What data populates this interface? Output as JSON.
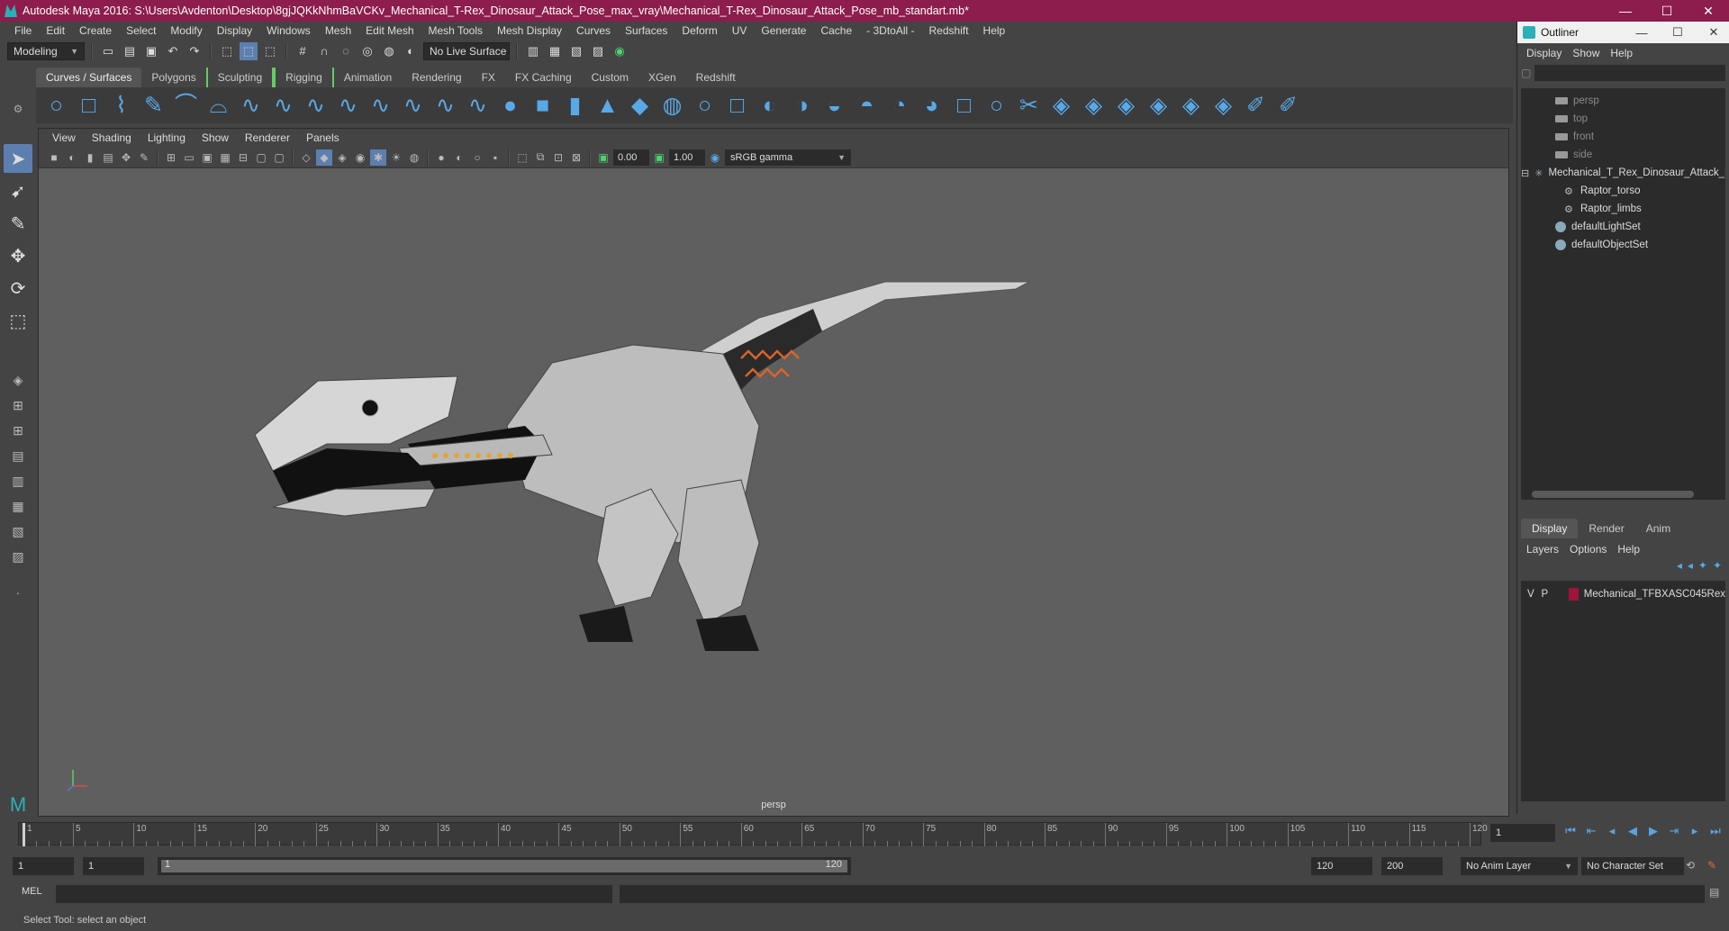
{
  "window": {
    "title": "Autodesk Maya 2016: S:\\Users\\Avdenton\\Desktop\\8gjJQKkNhmBaVCKv_Mechanical_T-Rex_Dinosaur_Attack_Pose_max_vray\\Mechanical_T-Rex_Dinosaur_Attack_Pose_mb_standart.mb*",
    "minimize": "—",
    "maximize": "☐",
    "close": "✕"
  },
  "menubar": [
    "File",
    "Edit",
    "Create",
    "Select",
    "Modify",
    "Display",
    "Windows",
    "Mesh",
    "Edit Mesh",
    "Mesh Tools",
    "Mesh Display",
    "Curves",
    "Surfaces",
    "Deform",
    "UV",
    "Generate",
    "Cache",
    "- 3DtoAll -",
    "Redshift",
    "Help"
  ],
  "statusline": {
    "mode": "Modeling",
    "live_surface": "No Live Surface"
  },
  "shelf_tabs": [
    "Curves / Surfaces",
    "Polygons",
    "Sculpting",
    "Rigging",
    "Animation",
    "Rendering",
    "FX",
    "FX Caching",
    "Custom",
    "XGen",
    "Redshift"
  ],
  "shelf_active": "Curves / Surfaces",
  "shelf_icons": [
    "circle-icon",
    "square-icon",
    "cv-curve-icon",
    "pencil-curve-icon",
    "ep-curve-icon",
    "arc-icon",
    "bezier-icon",
    "curve-icon",
    "curve-icon",
    "curve-icon",
    "curve-icon",
    "curve-icon",
    "curve-icon",
    "curve-icon",
    "sphere-icon",
    "cube-icon",
    "cylinder-icon",
    "cone-icon",
    "plane-icon",
    "torus-icon",
    "circle-icon",
    "square-icon",
    "revolve-icon",
    "loft-icon",
    "planar-icon",
    "extrude-icon",
    "birail-icon",
    "boundary-icon",
    "square-icon",
    "circle-icon",
    "trim-icon",
    "surface-icon",
    "surface-icon",
    "surface-icon",
    "surface-icon",
    "surface-icon",
    "surface-icon",
    "brush-icon",
    "brush-icon"
  ],
  "viewport": {
    "menus": [
      "View",
      "Shading",
      "Lighting",
      "Show",
      "Renderer",
      "Panels"
    ],
    "exposure": "0.00",
    "gamma_val": "1.00",
    "color_space": "sRGB gamma",
    "camera_label": "persp"
  },
  "outliner": {
    "title": "Outliner",
    "menus": [
      "Display",
      "Show",
      "Help"
    ],
    "items": [
      {
        "label": "persp",
        "type": "camera",
        "indent": 0,
        "dim": true
      },
      {
        "label": "top",
        "type": "camera",
        "indent": 0,
        "dim": true
      },
      {
        "label": "front",
        "type": "camera",
        "indent": 0,
        "dim": true
      },
      {
        "label": "side",
        "type": "camera",
        "indent": 0,
        "dim": true
      },
      {
        "label": "Mechanical_T_Rex_Dinosaur_Attack_Pose",
        "type": "group",
        "indent": 0,
        "dim": false
      },
      {
        "label": "Raptor_torso",
        "type": "mesh",
        "indent": 1,
        "dim": false
      },
      {
        "label": "Raptor_limbs",
        "type": "mesh",
        "indent": 1,
        "dim": false
      },
      {
        "label": "defaultLightSet",
        "type": "set",
        "indent": 0,
        "dim": false
      },
      {
        "label": "defaultObjectSet",
        "type": "set",
        "indent": 0,
        "dim": false
      }
    ]
  },
  "layer_editor": {
    "tabs": [
      "Display",
      "Render",
      "Anim"
    ],
    "active_tab": "Display",
    "menus": [
      "Layers",
      "Options",
      "Help"
    ],
    "layers": [
      {
        "v": "V",
        "p": "P",
        "name": "Mechanical_TFBXASC045Rex",
        "color": "#a0143c"
      }
    ]
  },
  "timeline": {
    "ticks": [
      1,
      5,
      10,
      15,
      20,
      25,
      30,
      35,
      40,
      45,
      50,
      55,
      60,
      65,
      70,
      75,
      80,
      85,
      90,
      95,
      100,
      105,
      110,
      115,
      120
    ],
    "current_frame": "1",
    "playback_icons": [
      "go-start-icon",
      "step-back-key-icon",
      "step-back-icon",
      "play-back-icon",
      "play-forward-icon",
      "step-forward-key-icon",
      "step-forward-icon",
      "go-end-icon"
    ]
  },
  "range": {
    "start": "1",
    "current": "1",
    "slider_start": "1",
    "slider_end": "120",
    "end": "120",
    "max": "200",
    "anim_layer": "No Anim Layer",
    "character_set": "No Character Set"
  },
  "command": {
    "label": "MEL"
  },
  "help_line": "Select Tool: select an object"
}
